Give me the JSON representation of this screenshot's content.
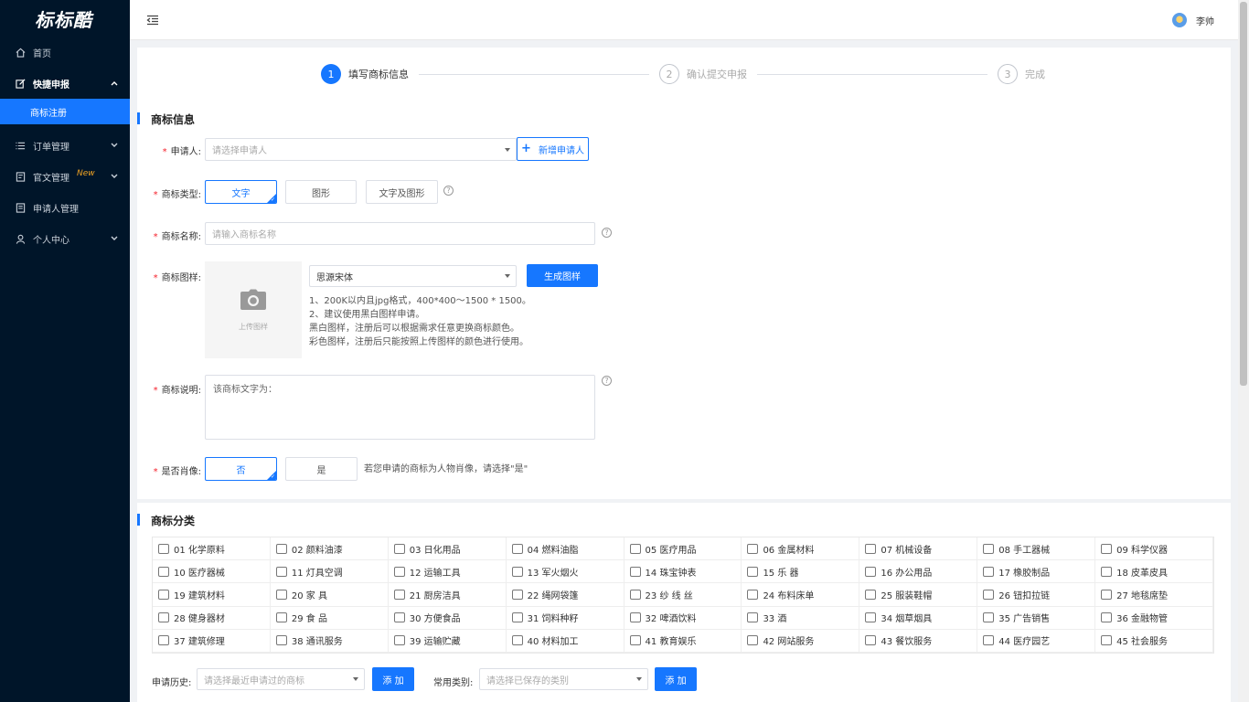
{
  "sidebar": {
    "logo": "标标酷",
    "items": [
      {
        "label": "首页",
        "icon": "home-icon"
      },
      {
        "label": "快捷申报",
        "icon": "edit-icon"
      },
      {
        "label": "订单管理",
        "icon": "list-icon"
      },
      {
        "label": "官文管理",
        "icon": "document-icon",
        "badge": "New"
      },
      {
        "label": "申请人管理",
        "icon": "contacts-icon"
      },
      {
        "label": "个人中心",
        "icon": "user-icon"
      }
    ],
    "sub_item": "商标注册"
  },
  "header": {
    "user_name": "李帅"
  },
  "steps": [
    {
      "num": "1",
      "label": "填写商标信息"
    },
    {
      "num": "2",
      "label": "确认提交申报"
    },
    {
      "num": "3",
      "label": "完成"
    }
  ],
  "info": {
    "section_title": "商标信息",
    "applicant": {
      "label": "申请人:",
      "placeholder": "请选择申请人",
      "add_button": "新增申请人"
    },
    "type": {
      "label": "商标类型:",
      "options": [
        "文字",
        "图形",
        "文字及图形"
      ]
    },
    "name": {
      "label": "商标名称:",
      "placeholder": "请输入商标名称"
    },
    "pattern": {
      "label": "商标图样:",
      "upload_text": "上传图样",
      "font_value": "思源宋体",
      "generate_button": "生成图样",
      "hints": [
        "1、200K以内且jpg格式，400*400～1500 * 1500。",
        "2、建议使用黑白图样申请。",
        "黑白图样，注册后可以根据需求任意更换商标颜色。",
        "彩色图样，注册后只能按照上传图样的颜色进行使用。"
      ]
    },
    "desc": {
      "label": "商标说明:",
      "value": "该商标文字为："
    },
    "portrait": {
      "label": "是否肖像:",
      "options": [
        "否",
        "是"
      ],
      "hint": "若您申请的商标为人物肖像，请选择\"是\""
    }
  },
  "classification": {
    "section_title": "商标分类",
    "categories": [
      "01 化学原料",
      "02 颜料油漆",
      "03 日化用品",
      "04 燃料油脂",
      "05 医疗用品",
      "06 金属材料",
      "07 机械设备",
      "08 手工器械",
      "09 科学仪器",
      "10 医疗器械",
      "11 灯具空调",
      "12 运输工具",
      "13 军火烟火",
      "14 珠宝钟表",
      "15 乐 器",
      "16 办公用品",
      "17 橡胶制品",
      "18 皮革皮具",
      "19 建筑材料",
      "20 家 具",
      "21 厨房洁具",
      "22 绳网袋篷",
      "23 纱 线 丝",
      "24 布料床单",
      "25 服装鞋帽",
      "26 钮扣拉链",
      "27 地毯席垫",
      "28 健身器材",
      "29 食 品",
      "30 方便食品",
      "31 饲料种籽",
      "32 啤酒饮料",
      "33 酒",
      "34 烟草烟具",
      "35 广告销售",
      "36 金融物管",
      "37 建筑修理",
      "38 通讯服务",
      "39 运输贮藏",
      "40 材料加工",
      "41 教育娱乐",
      "42 网站服务",
      "43 餐饮服务",
      "44 医疗园艺",
      "45 社会服务"
    ],
    "history": {
      "label": "申请历史:",
      "placeholder": "请选择最近申请过的商标",
      "button": "添 加"
    },
    "common": {
      "label": "常用类别:",
      "placeholder": "请选择已保存的类别",
      "button": "添 加"
    }
  },
  "colors": {
    "primary": "#1677ff",
    "sidebar_bg": "#001529",
    "required": "#f5222d"
  }
}
